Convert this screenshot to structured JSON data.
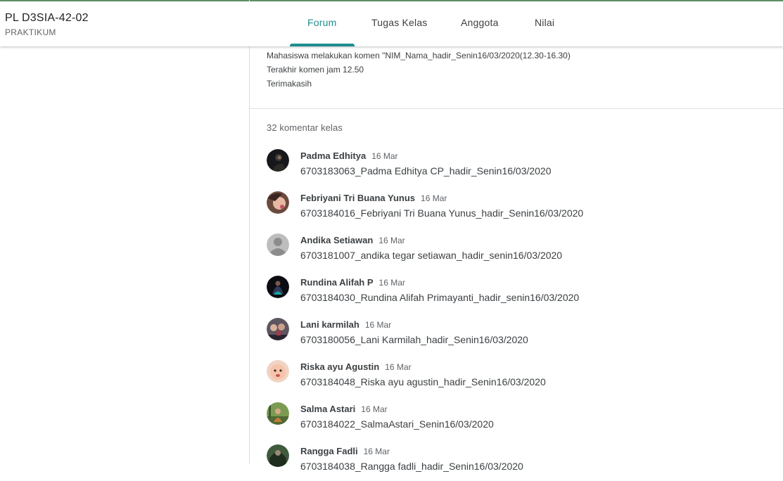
{
  "header": {
    "class_title": "PL D3SIA-42-02",
    "class_subtitle": "PRAKTIKUM",
    "tabs": [
      {
        "label": "Forum",
        "active": true
      },
      {
        "label": "Tugas Kelas",
        "active": false
      },
      {
        "label": "Anggota",
        "active": false
      },
      {
        "label": "Nilai",
        "active": false
      }
    ]
  },
  "post": {
    "lines": [
      "Mahasiswa melakukan komen \"NIM_Nama_hadir_Senin16/03/2020(12.30-16.30)",
      "Terakhir komen jam 12.50",
      "Terimakasih"
    ]
  },
  "comments_section": {
    "count_label": "32 komentar kelas",
    "comments": [
      {
        "name": "Padma Edhitya",
        "date": "16 Mar",
        "text": "6703183063_Padma Edhitya CP_hadir_Senin16/03/2020",
        "avatar": "photo-dark"
      },
      {
        "name": "Febriyani Tri Buana Yunus",
        "date": "16 Mar",
        "text": "6703184016_Febriyani Tri Buana Yunus_hadir_Senin16/03/2020",
        "avatar": "photo-selfie"
      },
      {
        "name": "Andika Setiawan",
        "date": "16 Mar",
        "text": "6703181007_andika tegar setiawan_hadir_senin16/03/2020",
        "avatar": "default-user"
      },
      {
        "name": "Rundina Alifah P",
        "date": "16 Mar",
        "text": "6703184030_Rundina Alifah Primayanti_hadir_senin16/03/2020",
        "avatar": "photo-dark-teal"
      },
      {
        "name": "Lani karmilah",
        "date": "16 Mar",
        "text": "6703180056_Lani Karmilah_hadir_Senin16/03/2020",
        "avatar": "photo-group"
      },
      {
        "name": "Riska ayu Agustin",
        "date": "16 Mar",
        "text": "6703184048_Riska ayu agustin_hadir_Senin16/03/2020",
        "avatar": "photo-baby"
      },
      {
        "name": "Salma Astari",
        "date": "16 Mar",
        "text": "6703184022_SalmaAstari_Senin16/03/2020",
        "avatar": "photo-outdoor"
      },
      {
        "name": "Rangga Fadli",
        "date": "16 Mar",
        "text": "6703184038_Rangga fadli_hadir_Senin16/03/2020",
        "avatar": "photo-nature"
      }
    ]
  },
  "colors": {
    "accent": "#1e8e8e",
    "top_line": "#5f9368",
    "text": "#3c4043",
    "muted": "#5f6368"
  }
}
